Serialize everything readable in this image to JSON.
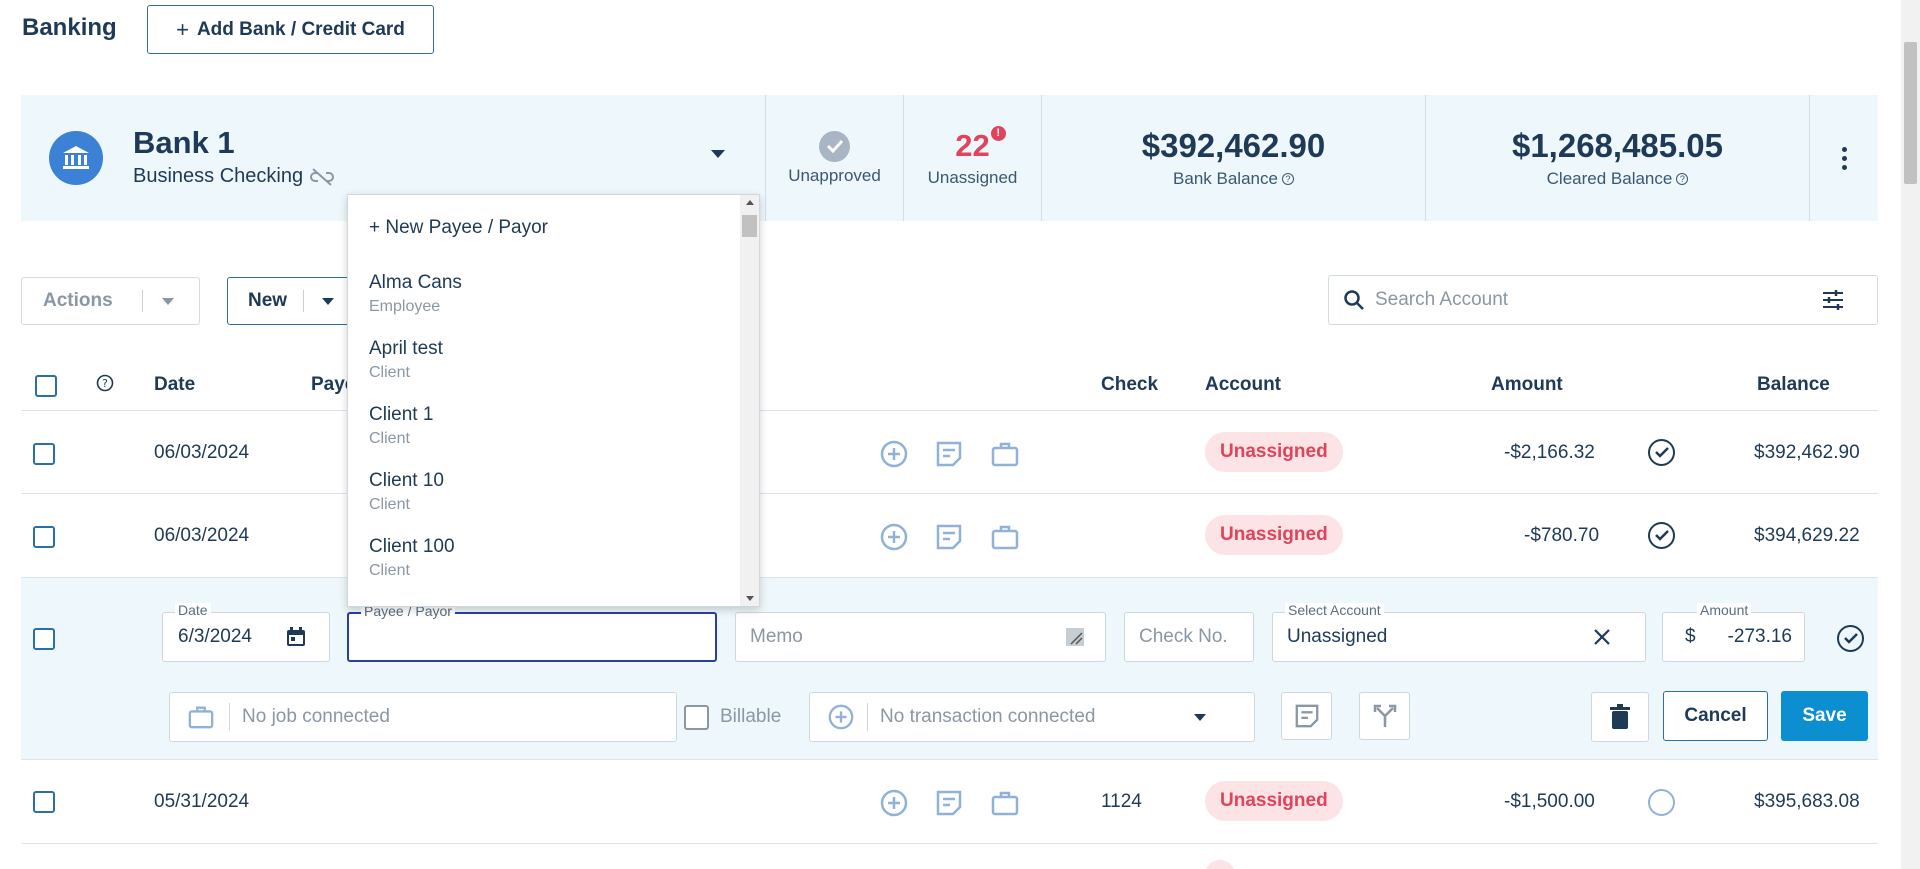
{
  "header": {
    "title": "Banking",
    "add_button_label": "Add Bank / Credit Card"
  },
  "bank_card": {
    "name": "Bank 1",
    "subtitle": "Business Checking",
    "unapproved_label": "Unapproved",
    "unassigned_count": "22",
    "unassigned_label": "Unassigned",
    "bank_balance": "$392,462.90",
    "bank_balance_label": "Bank Balance",
    "cleared_balance": "$1,268,485.05",
    "cleared_balance_label": "Cleared Balance"
  },
  "toolbar": {
    "actions_label": "Actions",
    "new_label": "New",
    "search_placeholder": "Search Account"
  },
  "table": {
    "columns": {
      "date": "Date",
      "payee": "Paye",
      "check": "Check",
      "account": "Account",
      "amount": "Amount",
      "balance": "Balance"
    },
    "rows": [
      {
        "date": "06/03/2024",
        "check": "",
        "account": "Unassigned",
        "amount": "-$2,166.32",
        "balance": "$392,462.90",
        "approved": true
      },
      {
        "date": "06/03/2024",
        "check": "",
        "account": "Unassigned",
        "amount": "-$780.70",
        "balance": "$394,629.22",
        "approved": true
      },
      {
        "date": "05/31/2024",
        "check": "1124",
        "account": "Unassigned",
        "amount": "-$1,500.00",
        "balance": "$395,683.08",
        "approved": false
      }
    ]
  },
  "edit_row": {
    "date_label": "Date",
    "date_value": "6/3/2024",
    "payee_label": "Payee / Payor",
    "payee_value": "",
    "memo_placeholder": "Memo",
    "check_placeholder": "Check No.",
    "account_label": "Select Account",
    "account_value": "Unassigned",
    "amount_label": "Amount",
    "amount_currency": "$",
    "amount_value": "-273.16",
    "job_placeholder": "No job connected",
    "billable_label": "Billable",
    "transaction_placeholder": "No transaction connected",
    "cancel_label": "Cancel",
    "save_label": "Save"
  },
  "payee_dropdown": {
    "new_option": "+ New Payee / Payor",
    "options": [
      {
        "name": "Alma Cans",
        "type": "Employee"
      },
      {
        "name": "April test",
        "type": "Client"
      },
      {
        "name": "Client 1",
        "type": "Client"
      },
      {
        "name": "Client 10",
        "type": "Client"
      },
      {
        "name": "Client 100",
        "type": "Client"
      }
    ]
  },
  "colors": {
    "primary": "#1f3a56",
    "accent_blue": "#0b8fd1",
    "bank_icon": "#3b82d6",
    "unassigned_red": "#e0445a",
    "pill_bg": "#fbe3e6",
    "card_bg": "#eef7fb"
  }
}
